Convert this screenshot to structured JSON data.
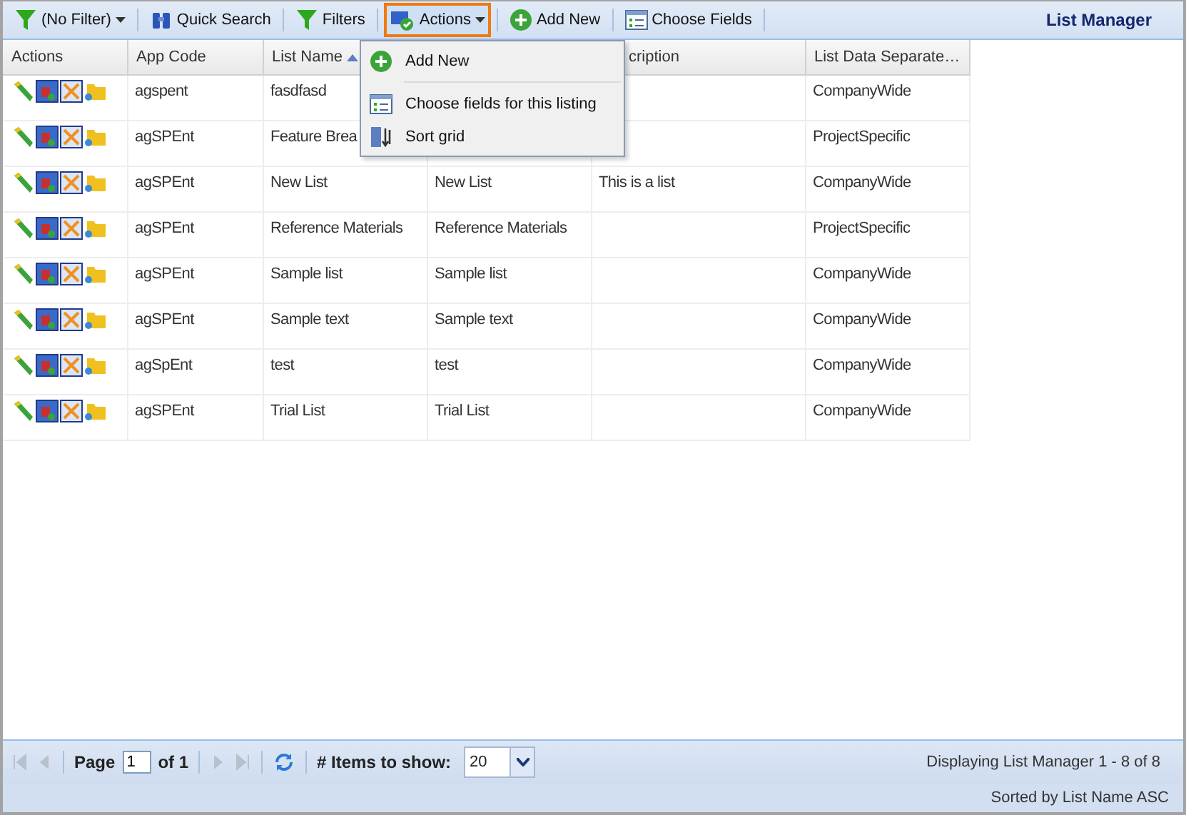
{
  "toolbar": {
    "items": [
      {
        "kind": "filter",
        "label": "(No Filter)",
        "dropdown": true,
        "expanded": false
      },
      {
        "kind": "search",
        "label": "Quick Search",
        "dropdown": false,
        "expanded": false
      },
      {
        "kind": "filter",
        "label": "Filters",
        "dropdown": false,
        "expanded": false
      },
      {
        "kind": "actions",
        "label": "Actions",
        "dropdown": true,
        "expanded": true
      },
      {
        "kind": "add",
        "label": "Add New",
        "dropdown": false,
        "expanded": false
      },
      {
        "kind": "fields",
        "label": "Choose Fields",
        "dropdown": false,
        "expanded": false
      }
    ],
    "title": "List Manager"
  },
  "menu": [
    {
      "kind": "add",
      "label": "Add New"
    },
    {
      "kind": "separator"
    },
    {
      "kind": "fields",
      "label": "Choose fields for this listing"
    },
    {
      "kind": "sort",
      "label": "Sort grid"
    }
  ],
  "table": {
    "columns": [
      {
        "label": "Actions",
        "sorted": false
      },
      {
        "label": "App Code",
        "sorted": false
      },
      {
        "label": "List Name",
        "sorted": true
      },
      {},
      {
        "label": "cription",
        "sorted": false
      },
      {
        "label": "List Data Separate…",
        "sorted": false
      }
    ],
    "rows": [
      [
        "",
        "agspent",
        "fasdfasd",
        "",
        "",
        "CompanyWide"
      ],
      [
        "",
        "agSPEnt",
        "Feature Brea",
        "",
        "",
        "ProjectSpecific"
      ],
      [
        "",
        "agSPEnt",
        "New List",
        "New List",
        "This is a list",
        "CompanyWide"
      ],
      [
        "",
        "agSPEnt",
        "Reference Materials",
        "Reference Materials",
        "",
        "ProjectSpecific"
      ],
      [
        "",
        "agSPEnt",
        "Sample list",
        "Sample list",
        "",
        "CompanyWide"
      ],
      [
        "",
        "agSPEnt",
        "Sample text",
        "Sample text",
        "",
        "CompanyWide"
      ],
      [
        "",
        "agSpEnt",
        "test",
        "test",
        "",
        "CompanyWide"
      ],
      [
        "",
        "agSPEnt",
        "Trial List",
        "Trial List",
        "",
        "CompanyWide"
      ]
    ]
  },
  "pager": {
    "page_label": "Page",
    "page": "1",
    "of": "of 1",
    "items_label": "# Items to show:",
    "items": "20",
    "display": "Displaying List Manager 1 - 8 of 8"
  },
  "status": "Sorted by List Name ASC"
}
